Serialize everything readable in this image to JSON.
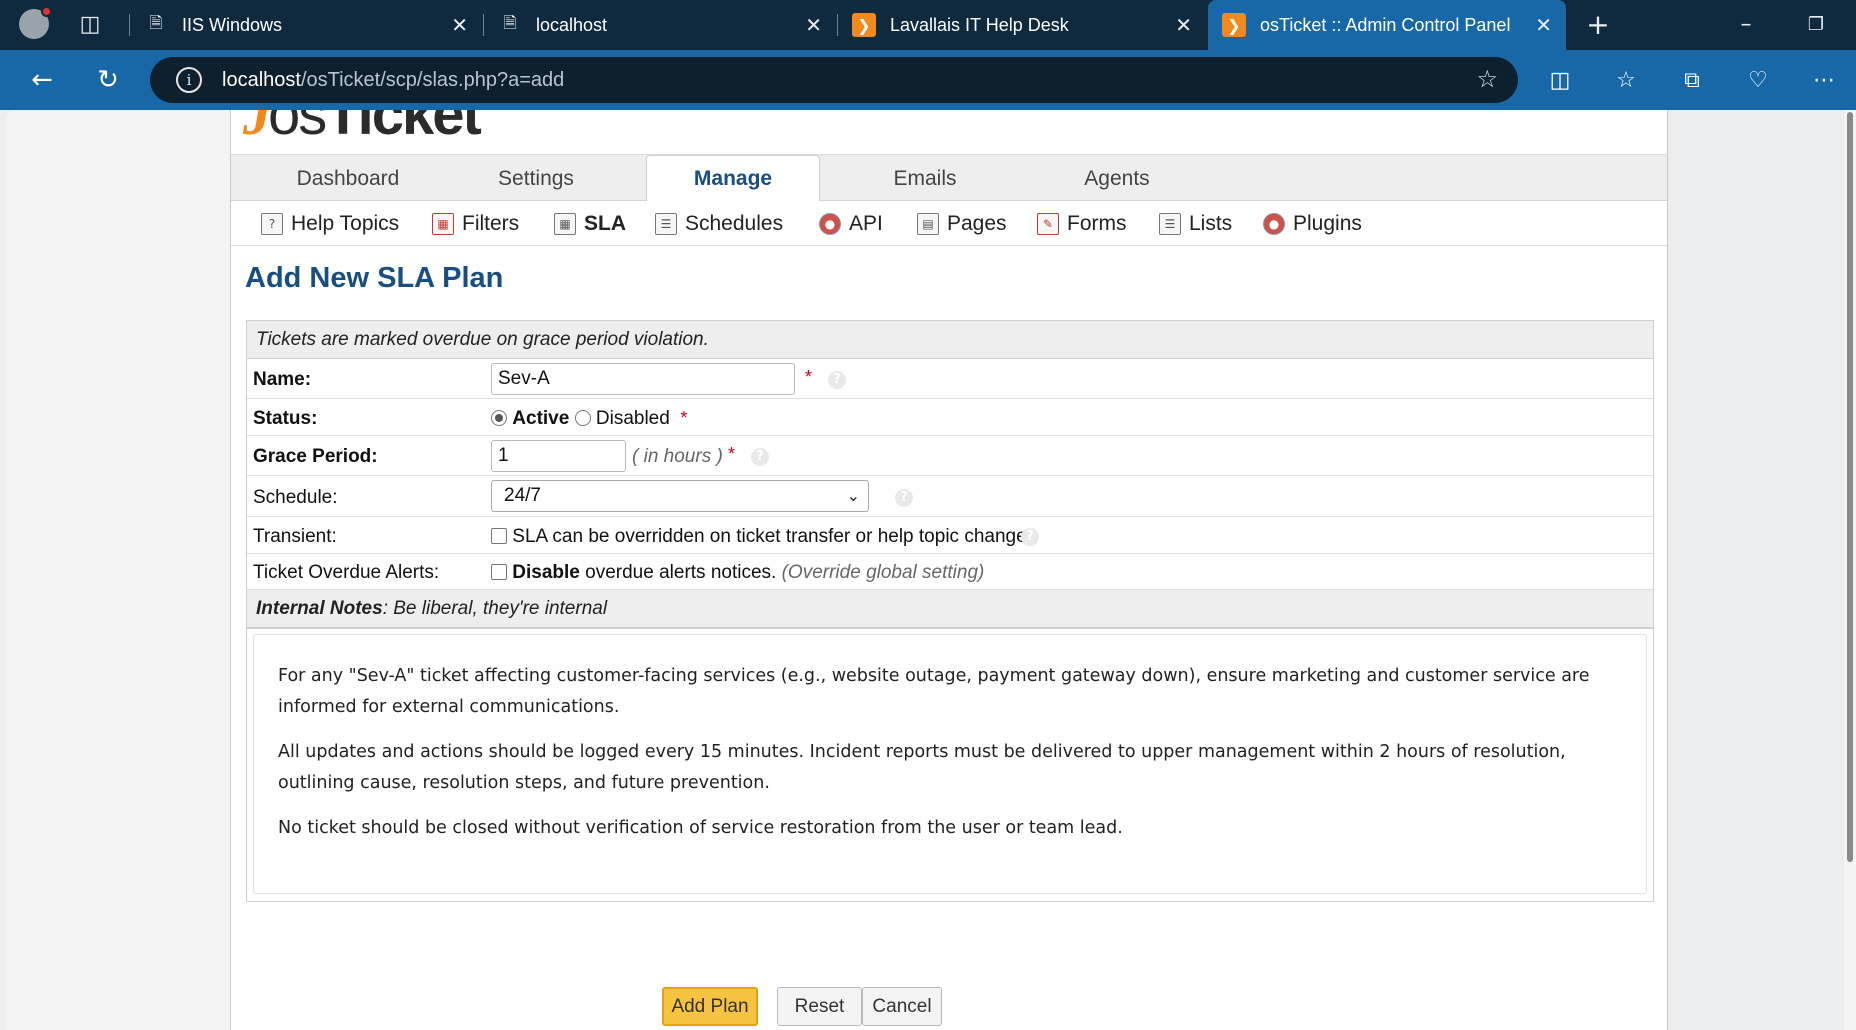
{
  "browser": {
    "tabs": [
      {
        "title": "IIS Windows",
        "icon": "page-icon"
      },
      {
        "title": "localhost",
        "icon": "broken-page-icon"
      },
      {
        "title": "Lavallais IT Help Desk",
        "icon": "osticket-icon"
      },
      {
        "title": "osTicket :: Admin Control Panel",
        "icon": "osticket-icon"
      }
    ],
    "url_host": "localhost",
    "url_path": "/osTicket/scp/slas.php?a=add"
  },
  "app": {
    "logo_mark": "J",
    "logo_os": "os",
    "logo_ticket": "Ticket",
    "nav_tabs": [
      "Dashboard",
      "Settings",
      "Manage",
      "Emails",
      "Agents"
    ],
    "active_tab": "Manage",
    "subnav": [
      "Help Topics",
      "Filters",
      "SLA",
      "Schedules",
      "API",
      "Pages",
      "Forms",
      "Lists",
      "Plugins"
    ],
    "active_subnav": "SLA"
  },
  "form": {
    "title": "Add New SLA Plan",
    "header_note": "Tickets are marked overdue on grace period violation.",
    "name_label": "Name:",
    "name_value": "Sev-A",
    "status_label": "Status:",
    "status_active": "Active",
    "status_disabled": "Disabled",
    "grace_label": "Grace Period:",
    "grace_value": "1",
    "grace_hint": "( in hours )",
    "schedule_label": "Schedule:",
    "schedule_value": "24/7",
    "transient_label": "Transient:",
    "transient_text": "SLA can be overridden on ticket transfer or help topic change",
    "alerts_label": "Ticket Overdue Alerts:",
    "alerts_bold": "Disable",
    "alerts_text": "overdue alerts notices.",
    "alerts_hint": "(Override global setting)",
    "notes_title": "Internal Notes",
    "notes_hint": ": Be liberal, they're internal",
    "required_mark": "*",
    "help_mark": "?",
    "notes": [
      "For any \"Sev-A\" ticket affecting customer-facing services (e.g., website outage, payment gateway down), ensure marketing and customer service are informed for external communications.",
      "All updates and actions should be logged every 15 minutes. Incident reports must be delivered to upper management within 2 hours of resolution, outlining cause, resolution steps, and future prevention.",
      "No ticket should be closed without verification of service restoration from the user or team lead."
    ]
  },
  "buttons": {
    "add": "Add Plan",
    "reset": "Reset",
    "cancel": "Cancel"
  },
  "colors": {
    "title_blue": "#184e81",
    "accent_orange": "#f08a1c",
    "primary_button": "#f6c343"
  }
}
